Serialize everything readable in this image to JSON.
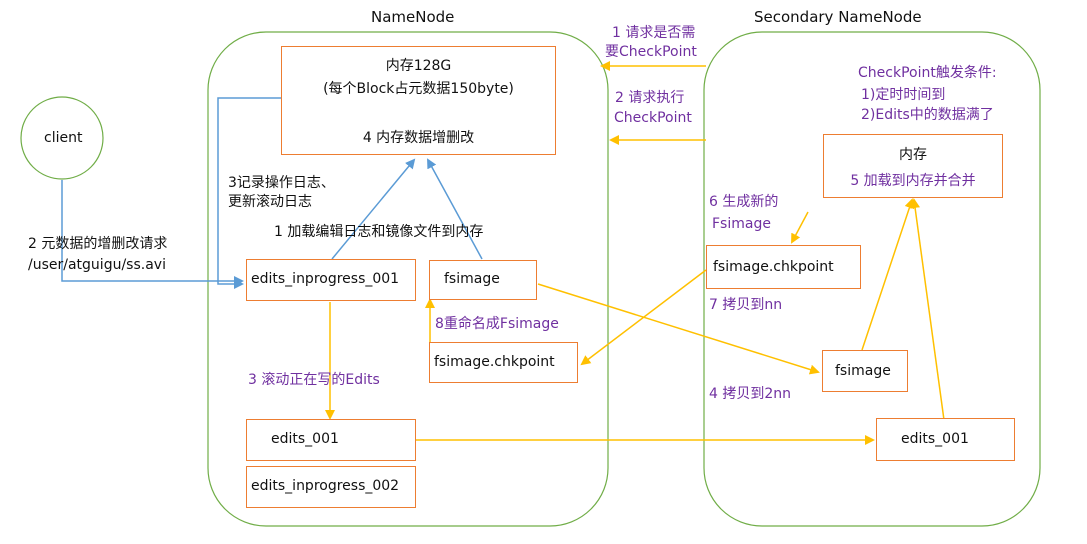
{
  "titles": {
    "namenode": "NameNode",
    "secondary": "Secondary NameNode"
  },
  "client": {
    "label": "client"
  },
  "namenode": {
    "memory_line1": "内存128G",
    "memory_line2": "(每个Block占元数据150byte)",
    "memory_line3": "4 内存数据增删改",
    "edits_inprogress_001": "edits_inprogress_001",
    "fsimage": "fsimage",
    "fsimage_chkpoint": "fsimage.chkpoint",
    "edits_001": "edits_001",
    "edits_inprogress_002": "edits_inprogress_002"
  },
  "secondary": {
    "memory_line1": "内存",
    "memory_line2": "5 加载到内存并合并",
    "fsimage_chkpoint": "fsimage.chkpoint",
    "fsimage": "fsimage",
    "edits_001": "edits_001"
  },
  "labels": {
    "request_meta_line1": "2 元数据的增删改请求",
    "request_meta_line2": "/user/atguigu/ss.avi",
    "log_line1": "3记录操作日志、",
    "log_line2": "更新滚动日志",
    "load_logs": "1 加载编辑日志和镜像文件到内存",
    "roll_edits": "3 滚动正在写的Edits",
    "rename": "8重命名成Fsimage",
    "ask_checkpoint_line1": "1 请求是否需",
    "ask_checkpoint_line2": "要CheckPoint",
    "exec_checkpoint_line1": "2 请求执行",
    "exec_checkpoint_line2": "CheckPoint",
    "trigger_line1": "CheckPoint触发条件:",
    "trigger_line2": "1)定时时间到",
    "trigger_line3": "2)Edits中的数据满了",
    "generate_line1": "6 生成新的",
    "generate_line2": "Fsimage",
    "copy_nn": "7 拷贝到nn",
    "copy_2nn": "4 拷贝到2nn"
  },
  "colors": {
    "green": "#70AD47",
    "orange": "#ED7D31",
    "blue": "#5B9BD5",
    "yellow_arrow": "#FFC000",
    "purple_text": "#7030A0"
  }
}
